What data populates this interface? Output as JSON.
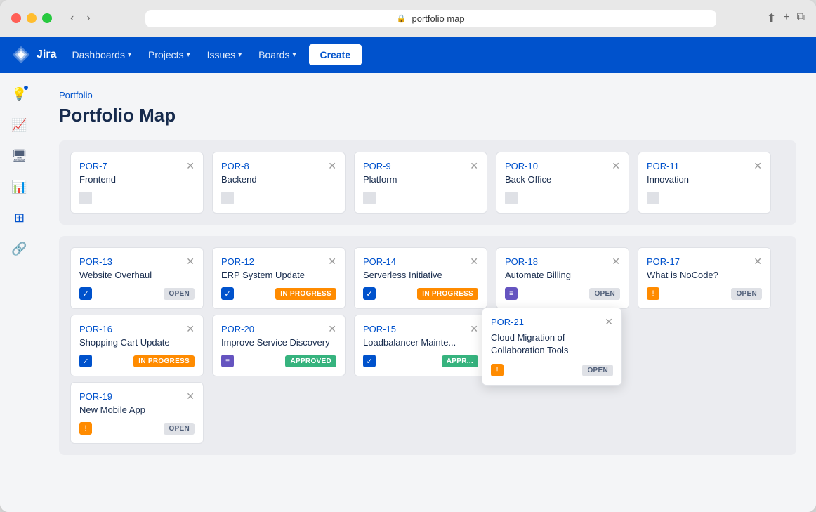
{
  "window": {
    "title": "portfolio map"
  },
  "nav": {
    "logo": "Jira",
    "items": [
      {
        "label": "Dashboards",
        "id": "dashboards"
      },
      {
        "label": "Projects",
        "id": "projects"
      },
      {
        "label": "Issues",
        "id": "issues"
      },
      {
        "label": "Boards",
        "id": "boards"
      }
    ],
    "create_label": "Create"
  },
  "breadcrumb": "Portfolio",
  "page_title": "Portfolio Map",
  "section1": {
    "cards": [
      {
        "id": "POR-7",
        "title": "Frontend"
      },
      {
        "id": "POR-8",
        "title": "Backend"
      },
      {
        "id": "POR-9",
        "title": "Platform"
      },
      {
        "id": "POR-10",
        "title": "Back Office"
      },
      {
        "id": "POR-11",
        "title": "Innovation"
      }
    ]
  },
  "section2": {
    "columns": [
      {
        "cards": [
          {
            "id": "POR-13",
            "title": "Website Overhaul",
            "icon": "check",
            "badge": "open",
            "badge_label": "OPEN"
          },
          {
            "id": "POR-16",
            "title": "Shopping Cart Update",
            "icon": "check",
            "badge": "in-progress",
            "badge_label": "IN PROGRESS"
          },
          {
            "id": "POR-19",
            "title": "New Mobile App",
            "icon": "warning",
            "badge": "open",
            "badge_label": "OPEN"
          }
        ]
      },
      {
        "cards": [
          {
            "id": "POR-12",
            "title": "ERP System Update",
            "icon": "check",
            "badge": "in-progress",
            "badge_label": "IN PROGRESS"
          },
          {
            "id": "POR-20",
            "title": "Improve Service Discovery",
            "icon": "list",
            "badge": "approved",
            "badge_label": "APPROVED"
          }
        ]
      },
      {
        "cards": [
          {
            "id": "POR-14",
            "title": "Serverless Initiative",
            "icon": "check",
            "badge": "in-progress",
            "badge_label": "IN PROGRESS"
          },
          {
            "id": "POR-15",
            "title": "Loadbalancer Maintenance",
            "icon": "check",
            "badge": "approved",
            "badge_label": "APPR..."
          }
        ]
      },
      {
        "cards": [
          {
            "id": "POR-18",
            "title": "Automate Billing",
            "icon": "list",
            "badge": "open",
            "badge_label": "OPEN"
          }
        ]
      },
      {
        "cards": [
          {
            "id": "POR-17",
            "title": "What is NoCode?",
            "icon": "warning",
            "badge": "open",
            "badge_label": "OPEN"
          }
        ]
      }
    ]
  },
  "popup": {
    "id": "POR-21",
    "title": "Cloud Migration of Collaboration Tools",
    "icon": "warning",
    "badge": "open",
    "badge_label": "OPEN"
  }
}
